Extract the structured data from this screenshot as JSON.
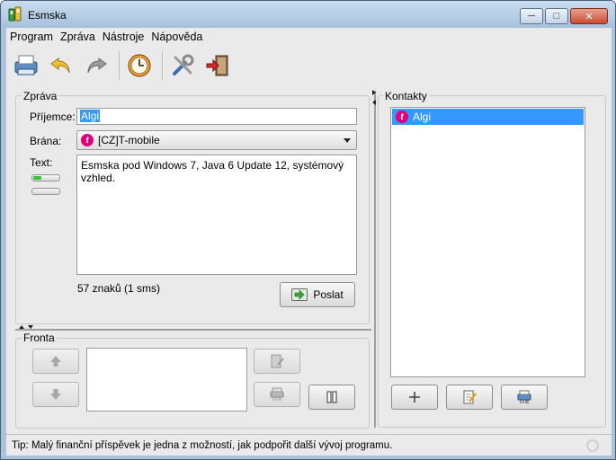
{
  "window": {
    "title": "Esmska",
    "controls": {
      "minimize": "─",
      "maximize": "□",
      "close": "✕"
    }
  },
  "menu": [
    "Program",
    "Zpráva",
    "Nástroje",
    "Nápověda"
  ],
  "toolbar": {
    "icons": [
      "sms-queue-icon",
      "undo-icon",
      "redo-icon",
      "history-clock-icon",
      "settings-tools-icon",
      "exit-icon"
    ]
  },
  "message": {
    "group_label": "Zpráva",
    "recipient_label": "Příjemce:",
    "recipient_value": "Algi",
    "gateway_label": "Brána:",
    "gateway_value": "[CZ]T-mobile",
    "text_label": "Text:",
    "text_value": "Esmska pod Windows 7, Java 6 Update 12, systémový vzhled.",
    "char_count": "57 znaků (1 sms)",
    "send_label": "Poslat",
    "sms_progress_fraction": 0.3
  },
  "queue": {
    "group_label": "Fronta"
  },
  "contacts": {
    "group_label": "Kontakty",
    "items": [
      {
        "name": "Algi",
        "gateway_logo": "t-mobile-logo"
      }
    ]
  },
  "status": {
    "tip": "Tip: Malý finanční příspěvek je jedna z možností, jak podpořit další vývoj programu."
  },
  "colors": {
    "selection": "#3399ff",
    "tmobile": "#e0007a",
    "send_arrow": "#36a836"
  }
}
